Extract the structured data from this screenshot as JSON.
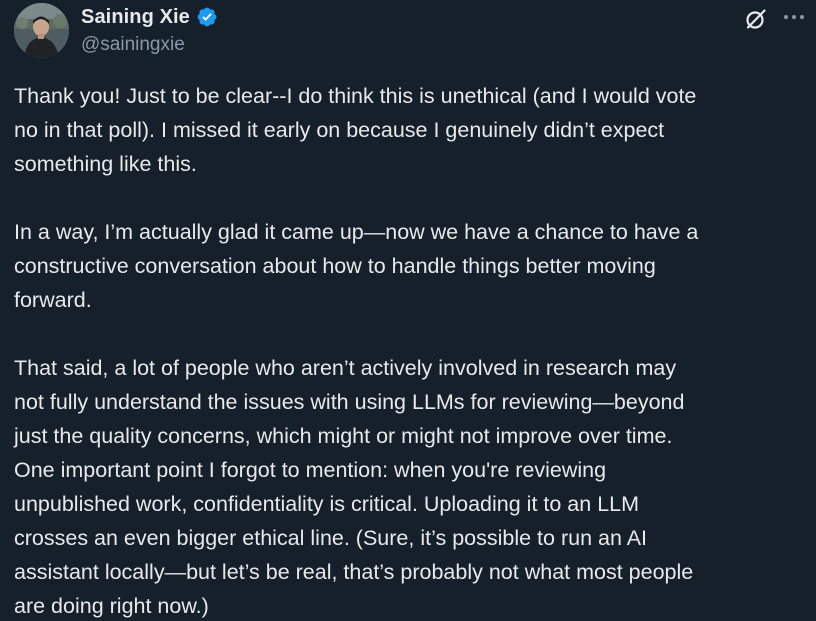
{
  "author": {
    "display_name": "Saining Xie",
    "handle": "@sainingxie",
    "verified": true,
    "verified_color": "#1d9bf0"
  },
  "actions": {
    "grok_icon": "slashed-circle-icon",
    "more_icon": "ellipsis-icon"
  },
  "tweet": {
    "paragraphs": [
      {
        "lines": [
          "Thank you! Just to be clear--I do think this is unethical (and I would vote",
          "no in that poll). I missed it early on because I genuinely didn’t expect",
          "something like this."
        ]
      },
      {
        "lines": [
          "In a way, I’m actually glad it came up—now we have a chance to have a",
          "constructive conversation about how to handle things better moving",
          "forward."
        ]
      },
      {
        "lines": [
          "That said, a lot of people who aren’t actively involved in research may",
          "not fully understand the issues with using LLMs for reviewing—beyond",
          "just the quality concerns, which might or might not improve over time.",
          "One important point I forgot to mention: when you're reviewing",
          "unpublished work, confidentiality is critical. Uploading it to an LLM",
          "crosses an even bigger ethical line. (Sure, it’s possible to run an AI",
          "assistant locally—but let’s be real, that’s probably not what most people",
          "are doing right now.)"
        ]
      }
    ]
  },
  "theme": {
    "background": "#15202b",
    "text": "#e7e9ea",
    "secondary_text": "#8b98a5"
  }
}
